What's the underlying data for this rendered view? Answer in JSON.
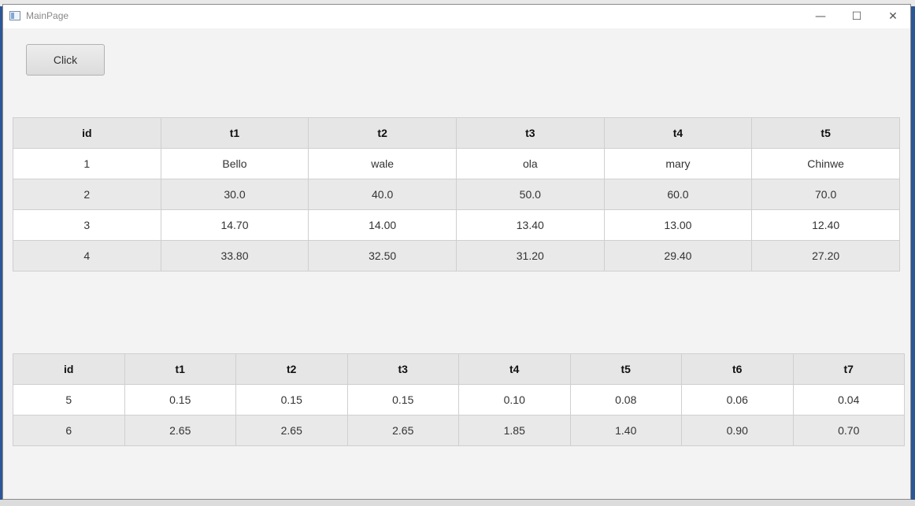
{
  "window": {
    "title": "MainPage"
  },
  "title_controls": {
    "minimize": "—",
    "maximize": "☐",
    "close": "✕"
  },
  "toolbar": {
    "click_label": "Click"
  },
  "table1": {
    "headers": [
      "id",
      "t1",
      "t2",
      "t3",
      "t4",
      "t5"
    ],
    "rows": [
      [
        "1",
        "Bello",
        "wale",
        "ola",
        "mary",
        "Chinwe"
      ],
      [
        "2",
        "30.0",
        "40.0",
        "50.0",
        "60.0",
        "70.0"
      ],
      [
        "3",
        "14.70",
        "14.00",
        "13.40",
        "13.00",
        "12.40"
      ],
      [
        "4",
        "33.80",
        "32.50",
        "31.20",
        "29.40",
        "27.20"
      ]
    ]
  },
  "table2": {
    "headers": [
      "id",
      "t1",
      "t2",
      "t3",
      "t4",
      "t5",
      "t6",
      "t7"
    ],
    "rows": [
      [
        "5",
        "0.15",
        "0.15",
        "0.15",
        "0.10",
        "0.08",
        "0.06",
        "0.04"
      ],
      [
        "6",
        "2.65",
        "2.65",
        "2.65",
        "1.85",
        "1.40",
        "0.90",
        "0.70"
      ]
    ]
  },
  "icons": {
    "app": "window-app-icon"
  }
}
